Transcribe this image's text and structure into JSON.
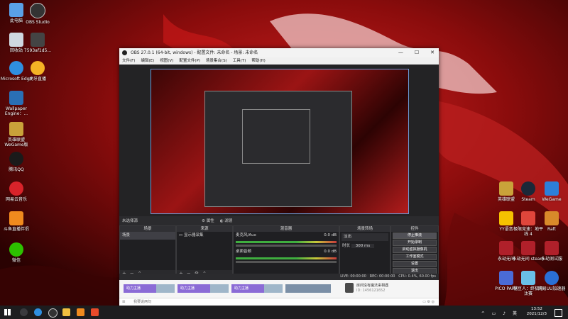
{
  "desktop": {
    "left_icons": [
      {
        "label": "此电脑",
        "color": "#5aa0e6"
      },
      {
        "label": "OBS Studio",
        "color": "#333333"
      },
      {
        "label": "回收站",
        "color": "#cfd8e0"
      },
      {
        "label": "7593af1d5...",
        "color": "#444444"
      },
      {
        "label": "Microsoft Edge",
        "color": "#2f8fe0"
      },
      {
        "label": "虎牙直播",
        "color": "#f5b325"
      },
      {
        "label": "Wallpaper Engine：...",
        "color": "#2a6fb5"
      },
      {
        "label": "英雄联盟 WeGame版",
        "color": "#c9a23a"
      },
      {
        "label": "腾讯QQ",
        "color": "#1a1a1a"
      },
      {
        "label": "网易云音乐",
        "color": "#d8232a"
      },
      {
        "label": "斗鱼直播伴侣",
        "color": "#f08a1e"
      },
      {
        "label": "微信",
        "color": "#2dc100"
      }
    ],
    "right_icons": [
      {
        "label": "英雄联盟",
        "color": "#c9a23a"
      },
      {
        "label": "Steam",
        "color": "#1b2838"
      },
      {
        "label": "WeGame",
        "color": "#2c7fd9"
      },
      {
        "label": "YY语音",
        "color": "#f5c200"
      },
      {
        "label": "极限竞速：地平线 4",
        "color": "#e0463b"
      },
      {
        "label": "Raft",
        "color": "#d88a2a"
      },
      {
        "label": "永劫无间",
        "color": "#b0202a"
      },
      {
        "label": "永劫无间 steam",
        "color": "#b0202a"
      },
      {
        "label": "永劫测试服",
        "color": "#b0202a"
      },
      {
        "label": "PICO PARK",
        "color": "#4a6bd6"
      },
      {
        "label": "糖豆人：终极淘汰赛",
        "color": "#6ac0e8"
      },
      {
        "label": "网易UU加速器",
        "color": "#2a6fd6"
      }
    ]
  },
  "obs": {
    "title": "OBS 27.0.1 (64-bit, windows) - 配置文件: 未命名 - 场景: 未命名",
    "win_buttons": [
      "—",
      "☐",
      "✕"
    ],
    "menu": [
      "文件(F)",
      "编辑(E)",
      "视图(V)",
      "配置文件(P)",
      "场景集合(S)",
      "工具(T)",
      "帮助(H)"
    ],
    "source_bar": {
      "label": "未选择源",
      "props": "属性",
      "filters": "滤镜"
    },
    "docks": {
      "scenes": {
        "title": "场景",
        "items": [
          "场景"
        ]
      },
      "sources": {
        "title": "来源",
        "items": [
          "显示器采集"
        ]
      },
      "mixer": {
        "title": "混音器",
        "channels": [
          {
            "name": "麦克风/Aux",
            "db": "0.0 dB"
          },
          {
            "name": "桌面音频",
            "db": "0.0 dB"
          }
        ]
      },
      "transitions": {
        "title": "场景转场",
        "type": "淡出",
        "duration_label": "时长",
        "duration": "300 ms"
      },
      "controls": {
        "title": "控件",
        "buttons": [
          "停止推流",
          "开始录制",
          "启动虚拟摄像机",
          "工作室模式",
          "设置",
          "退出"
        ]
      }
    },
    "status": {
      "live": "LIVE: 00:00:00",
      "rec": "REC: 00:00:00",
      "cpu": "CPU: 0.4%, 60.00 fps"
    },
    "browser": {
      "tiles": [
        "助力主播",
        "助力主播",
        "助力主播"
      ],
      "room_text": "房间没有魔法来相遇",
      "room_id": "ID: 1456121652",
      "input_placeholder": "我要说两句"
    }
  },
  "taskbar": {
    "time": "13:52",
    "date": "2021/12/3",
    "lang": "英"
  }
}
